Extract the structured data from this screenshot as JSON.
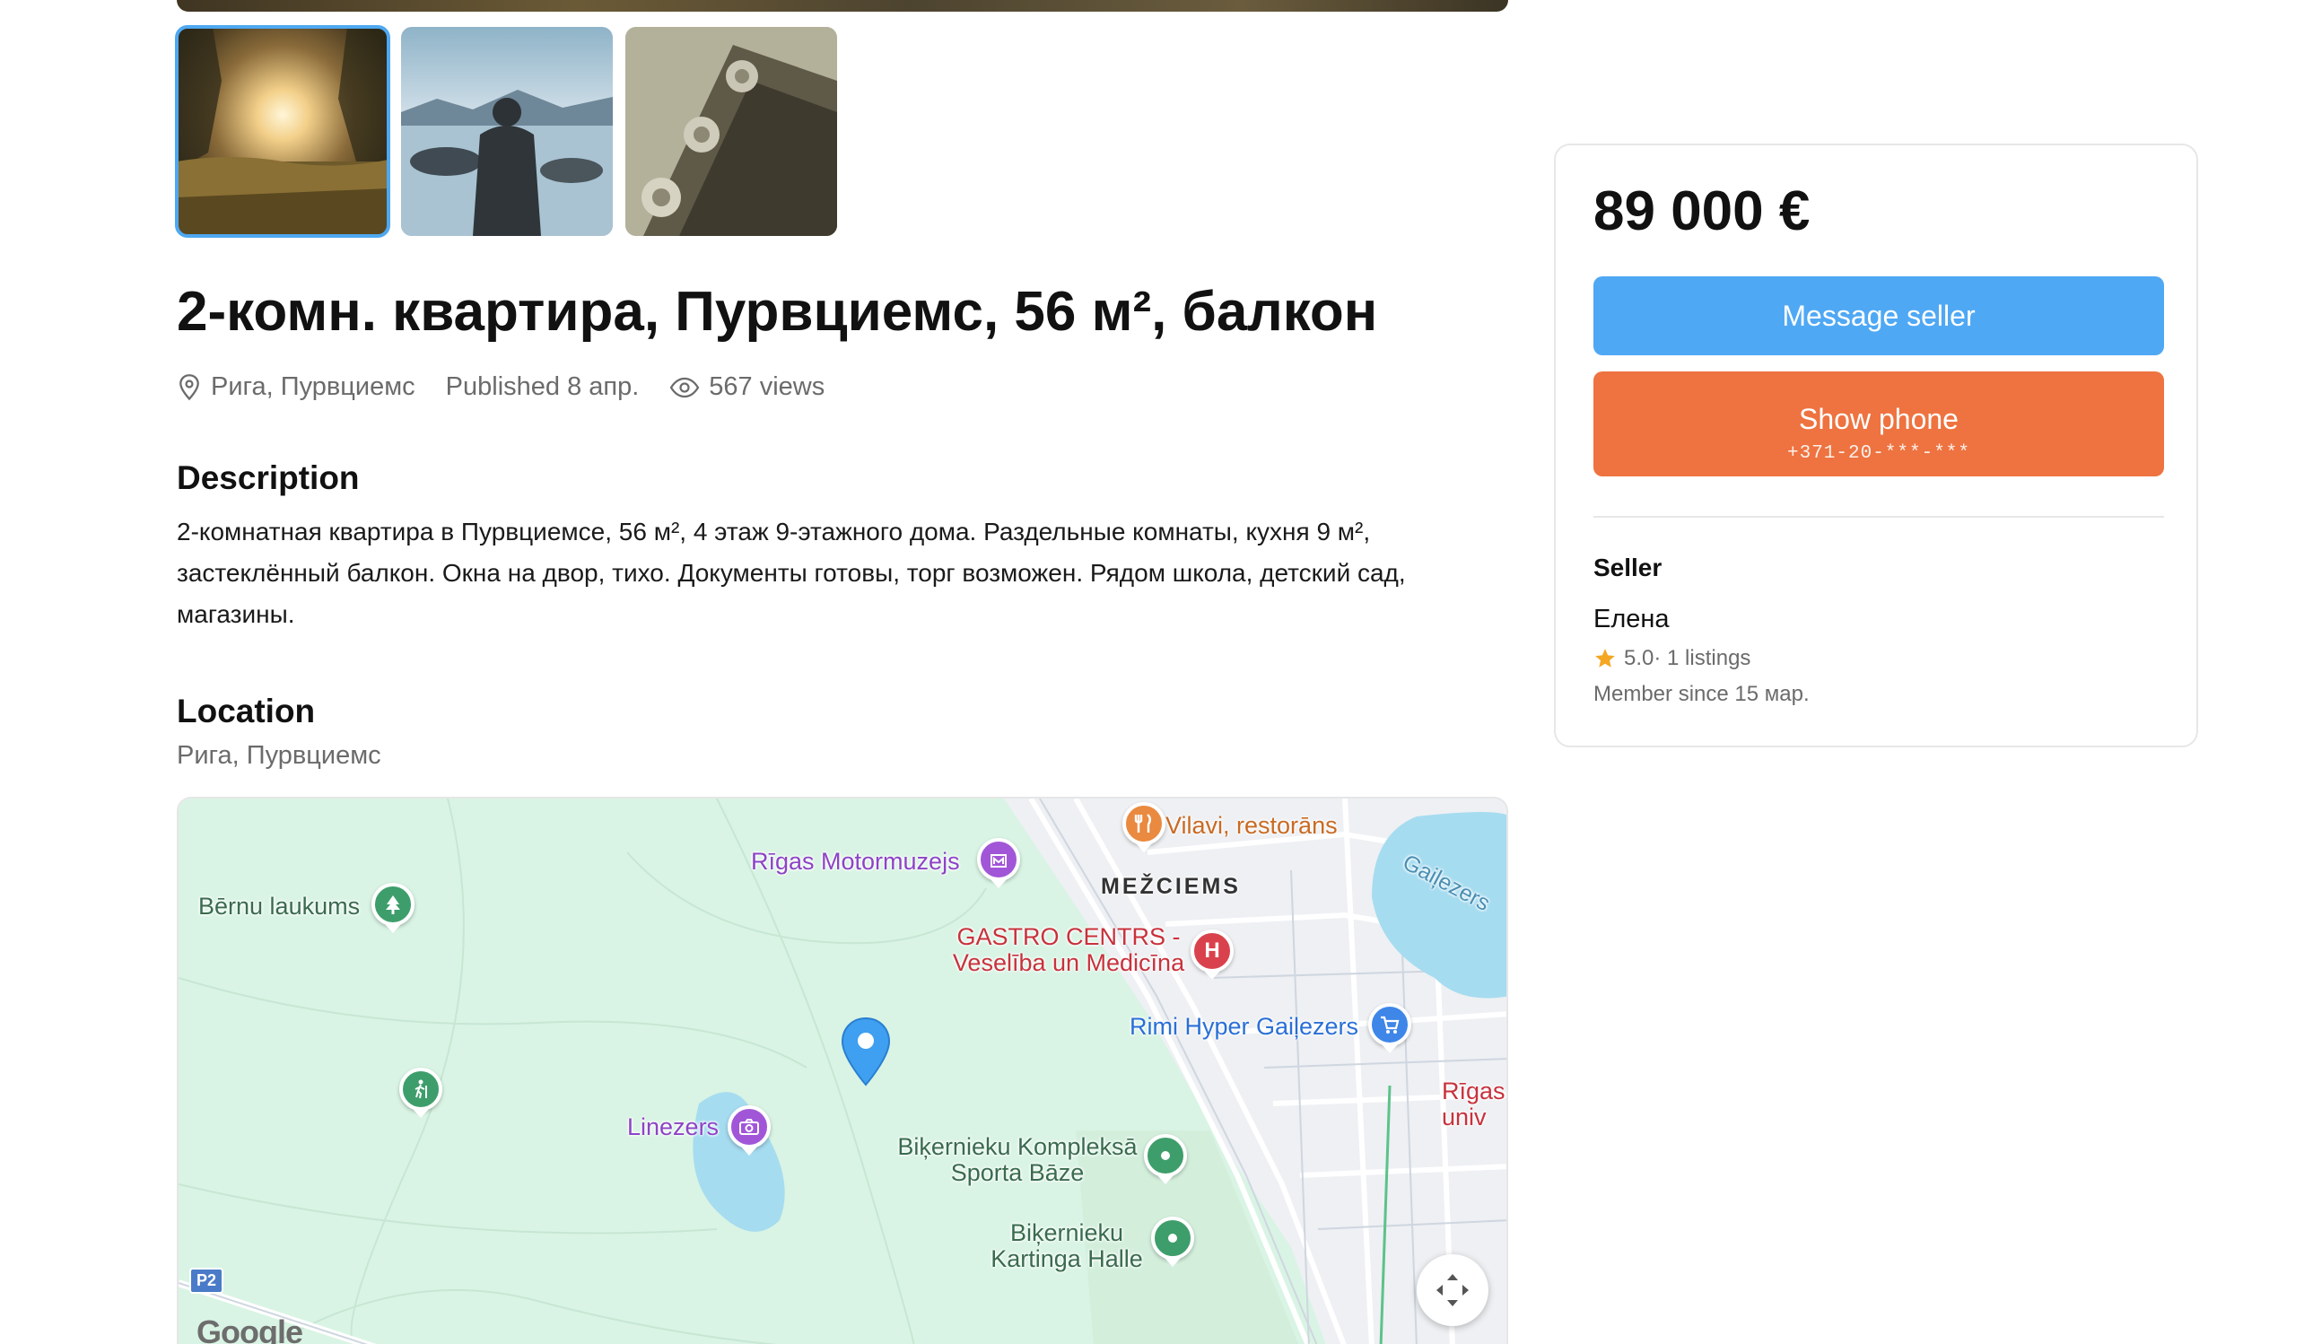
{
  "gallery": {
    "thumbnails": [
      {
        "label": "sunset-field-photo",
        "active": true
      },
      {
        "label": "man-at-lake-photo",
        "active": false
      },
      {
        "label": "guitar-headstock-photo",
        "active": false
      }
    ]
  },
  "listing": {
    "title": "2-комн. квартира, Пурвциемс, 56 м², балкон",
    "location": "Рига, Пурвциемс",
    "published": "Published 8 апр.",
    "views": "567 views",
    "description_heading": "Description",
    "description": "2-комнатная квартира в Пурвциемсе, 56 м², 4 этаж 9-этажного дома. Раздельные комнаты, кухня 9 м², застеклённый балкон. Окна на двор, тихо. Документы готовы, торг возможен. Рядом школа, детский сад, магазины.",
    "location_heading": "Location",
    "location_sub": "Рига, Пурвциемс"
  },
  "map": {
    "labels": {
      "vilavi": "Vilavi, restorāns",
      "motormuzejs": "Rīgas Motormuzejs",
      "mezciems": "MEŽCIEMS",
      "gailezers_lake": "Gaiļezers",
      "bernu_laukums": "Bērnu laukums",
      "gastro_1": "GASTRO CENTRS -",
      "gastro_2": "Veselība un Medicīna",
      "rimi": "Rimi Hyper Gaiļezers",
      "rigas_1": "Rīgas",
      "rigas_2": "univ",
      "linezers": "Linezers",
      "bikernieku_sport_1": "Biķernieku Kompleksā",
      "bikernieku_sport_2": "Sporta Bāze",
      "bikernieku_kart_1": "Biķernieku",
      "bikernieku_kart_2": "Kartinga Halle",
      "p2": "P2",
      "google": "Google",
      "hospital_glyph": "H"
    },
    "colors": {
      "park": "#d9f4e4",
      "urban": "#f1f2f4",
      "water": "#a6dcf0",
      "road": "#ffffff",
      "poi_green": "#3e9e6b",
      "poi_purple": "#a156d8",
      "poi_red": "#d9424c",
      "poi_blue": "#3e86e8",
      "poi_orange": "#e98a40",
      "pin": "#3f9ff0"
    }
  },
  "sidebar": {
    "price": "89 000 €",
    "message_button": "Message seller",
    "phone_button": "Show phone",
    "phone_masked": "+371-20-***-***",
    "seller_heading": "Seller",
    "seller_name": "Елена",
    "rating": "5.0",
    "listings": " · 1 listings",
    "member_since": "Member since 15 мар."
  },
  "colors": {
    "accent_blue": "#4fa8f4",
    "accent_orange": "#ee7340",
    "star": "#f5a623"
  }
}
